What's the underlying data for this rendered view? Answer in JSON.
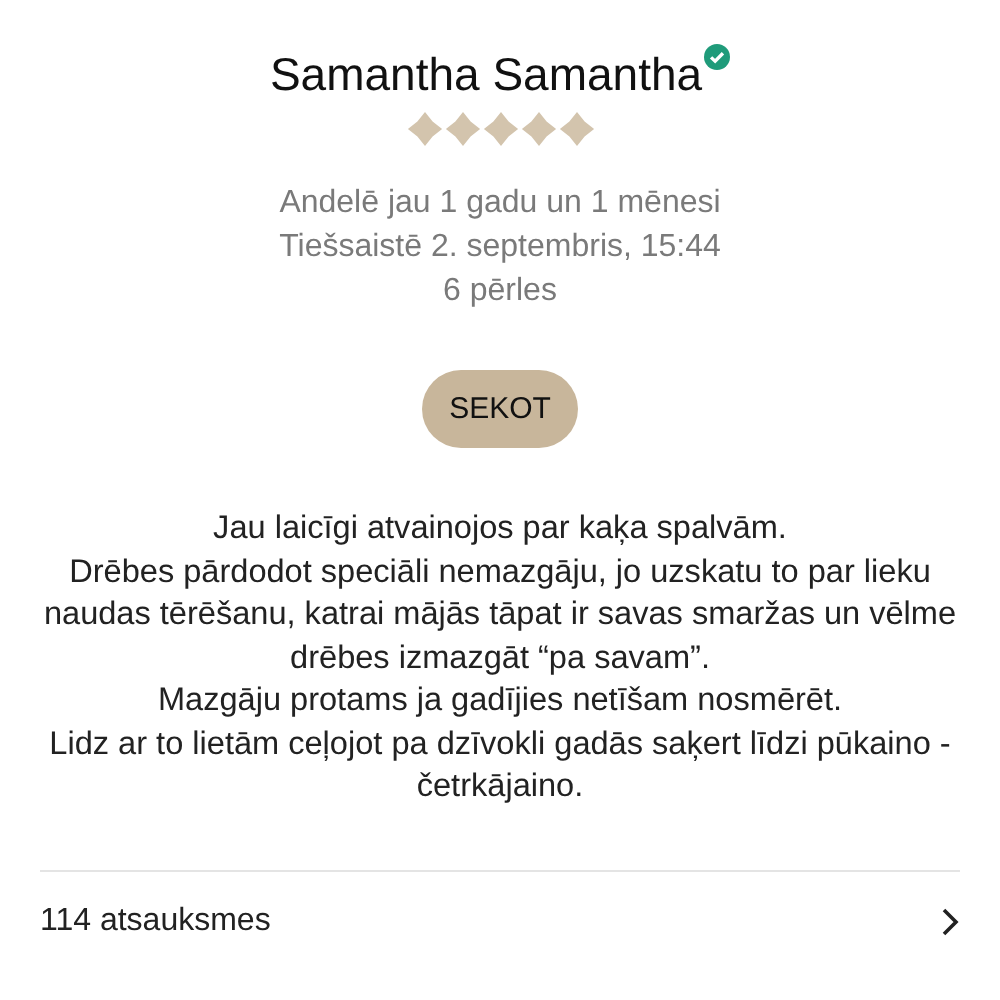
{
  "profile": {
    "name": "Samantha Samantha",
    "verified": true,
    "stars": 5,
    "details": [
      "Andelē jau 1 gadu un 1 mēnesi",
      "Tiešsaistē 2. septembris, 15:44",
      "6 pērles"
    ],
    "follow_button": "SEKOT",
    "bio": [
      "Jau laicīgi atvainojos par kaķa spalvām.",
      "Drēbes pārdodot speciāli nemazgāju, jo uzskatu to par lieku naudas tērēšanu, katrai mājās tāpat ir savas smaržas un vēlme drēbes izmazgāt “pa savam”.",
      "Mazgāju protams ja gadījies netīšam nosmērēt.",
      "Lidz ar to lietām ceļojot pa dzīvokli gadās saķert līdzi pūkaino - četrkājaino."
    ]
  },
  "reviews_link": {
    "label": "114 atsauksmes"
  }
}
